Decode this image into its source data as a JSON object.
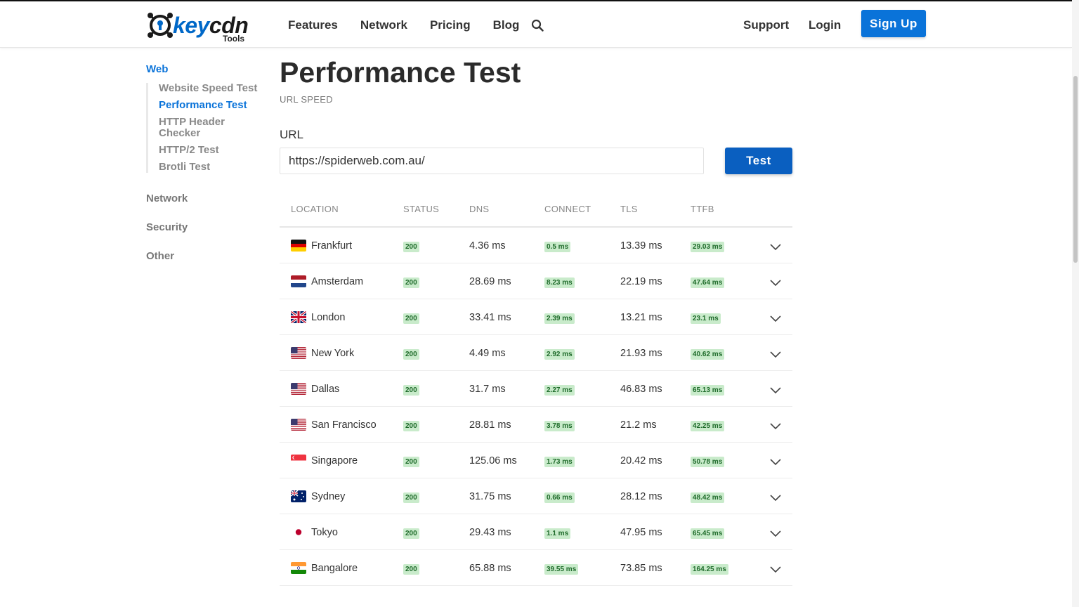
{
  "brand": {
    "logo_text_key": "key",
    "logo_text_cdn": "cdn",
    "logo_sub": "Tools",
    "accent": "#0a73d9"
  },
  "nav": {
    "items": [
      "Features",
      "Network",
      "Pricing",
      "Blog"
    ],
    "support": "Support",
    "login": "Login",
    "signup": "Sign Up",
    "search_icon": "search-icon"
  },
  "sidebar": {
    "web": "Web",
    "web_items": [
      "Website Speed Test",
      "Performance Test",
      "HTTP Header Checker",
      "HTTP/2 Test",
      "Brotli Test"
    ],
    "active": "Performance Test",
    "network": "Network",
    "security": "Security",
    "other": "Other"
  },
  "main": {
    "title": "Performance Test",
    "subtitle": "URL SPEED",
    "url_label": "URL",
    "url_value": "https://spiderweb.com.au/",
    "test_button": "Test"
  },
  "table": {
    "columns": [
      "LOCATION",
      "STATUS",
      "DNS",
      "CONNECT",
      "TLS",
      "TTFB"
    ],
    "rows": [
      {
        "flag": "de-flag-icon",
        "location": "Frankfurt",
        "status": "200",
        "dns": "4.36 ms",
        "connect": "0.5 ms",
        "tls": "13.39 ms",
        "ttfb": "29.03 ms"
      },
      {
        "flag": "nl-flag-icon",
        "location": "Amsterdam",
        "status": "200",
        "dns": "28.69 ms",
        "connect": "8.23 ms",
        "tls": "22.19 ms",
        "ttfb": "47.64 ms"
      },
      {
        "flag": "uk-flag-icon",
        "location": "London",
        "status": "200",
        "dns": "33.41 ms",
        "connect": "2.39 ms",
        "tls": "13.21 ms",
        "ttfb": "23.1 ms"
      },
      {
        "flag": "us-flag-icon",
        "location": "New York",
        "status": "200",
        "dns": "4.49 ms",
        "connect": "2.92 ms",
        "tls": "21.93 ms",
        "ttfb": "40.62 ms"
      },
      {
        "flag": "us-flag-icon",
        "location": "Dallas",
        "status": "200",
        "dns": "31.7 ms",
        "connect": "2.27 ms",
        "tls": "46.83 ms",
        "ttfb": "65.13 ms"
      },
      {
        "flag": "us-flag-icon",
        "location": "San Francisco",
        "status": "200",
        "dns": "28.81 ms",
        "connect": "3.78 ms",
        "tls": "21.2 ms",
        "ttfb": "42.25 ms"
      },
      {
        "flag": "sg-flag-icon",
        "location": "Singapore",
        "status": "200",
        "dns": "125.06 ms",
        "connect": "1.73 ms",
        "tls": "20.42 ms",
        "ttfb": "50.78 ms"
      },
      {
        "flag": "au-flag-icon",
        "location": "Sydney",
        "status": "200",
        "dns": "31.75 ms",
        "connect": "0.66 ms",
        "tls": "28.12 ms",
        "ttfb": "48.42 ms"
      },
      {
        "flag": "jp-flag-icon",
        "location": "Tokyo",
        "status": "200",
        "dns": "29.43 ms",
        "connect": "1.1 ms",
        "tls": "47.95 ms",
        "ttfb": "65.45 ms"
      },
      {
        "flag": "in-flag-icon",
        "location": "Bangalore",
        "status": "200",
        "dns": "65.88 ms",
        "connect": "39.55 ms",
        "tls": "73.85 ms",
        "ttfb": "164.25 ms"
      }
    ]
  }
}
